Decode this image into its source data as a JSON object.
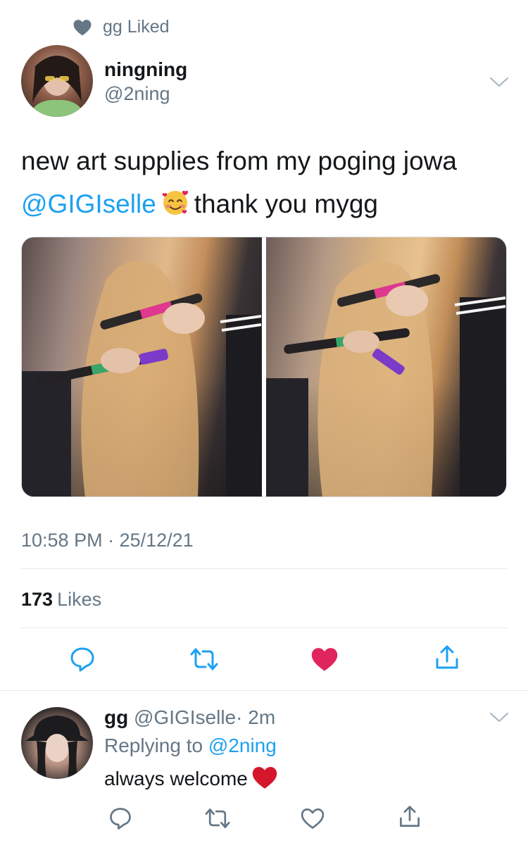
{
  "social_context": {
    "icon": "heart-icon",
    "text": "gg Liked"
  },
  "tweet": {
    "author_name": "ningning",
    "author_handle": "@2ning",
    "text_line1": "new art supplies from my poging jowa",
    "mention": "@GIGIselle",
    "emoji": "smiling-face-with-hearts",
    "text_after_emoji": "thank you mygg",
    "timestamp": "10:58 PM · 25/12/21",
    "likes_count": "173",
    "likes_label": "Likes",
    "liked": true
  },
  "reply": {
    "author_name": "gg",
    "author_handle": "@GIGIselle",
    "time": "· 2m",
    "replying_prefix": "Replying to",
    "replying_to": "@2ning",
    "text": "always welcome",
    "emoji": "red-heart"
  },
  "colors": {
    "accent": "#1da1f2",
    "like": "#e0245e",
    "secondary_text": "#657786",
    "primary_text": "#14171a"
  }
}
